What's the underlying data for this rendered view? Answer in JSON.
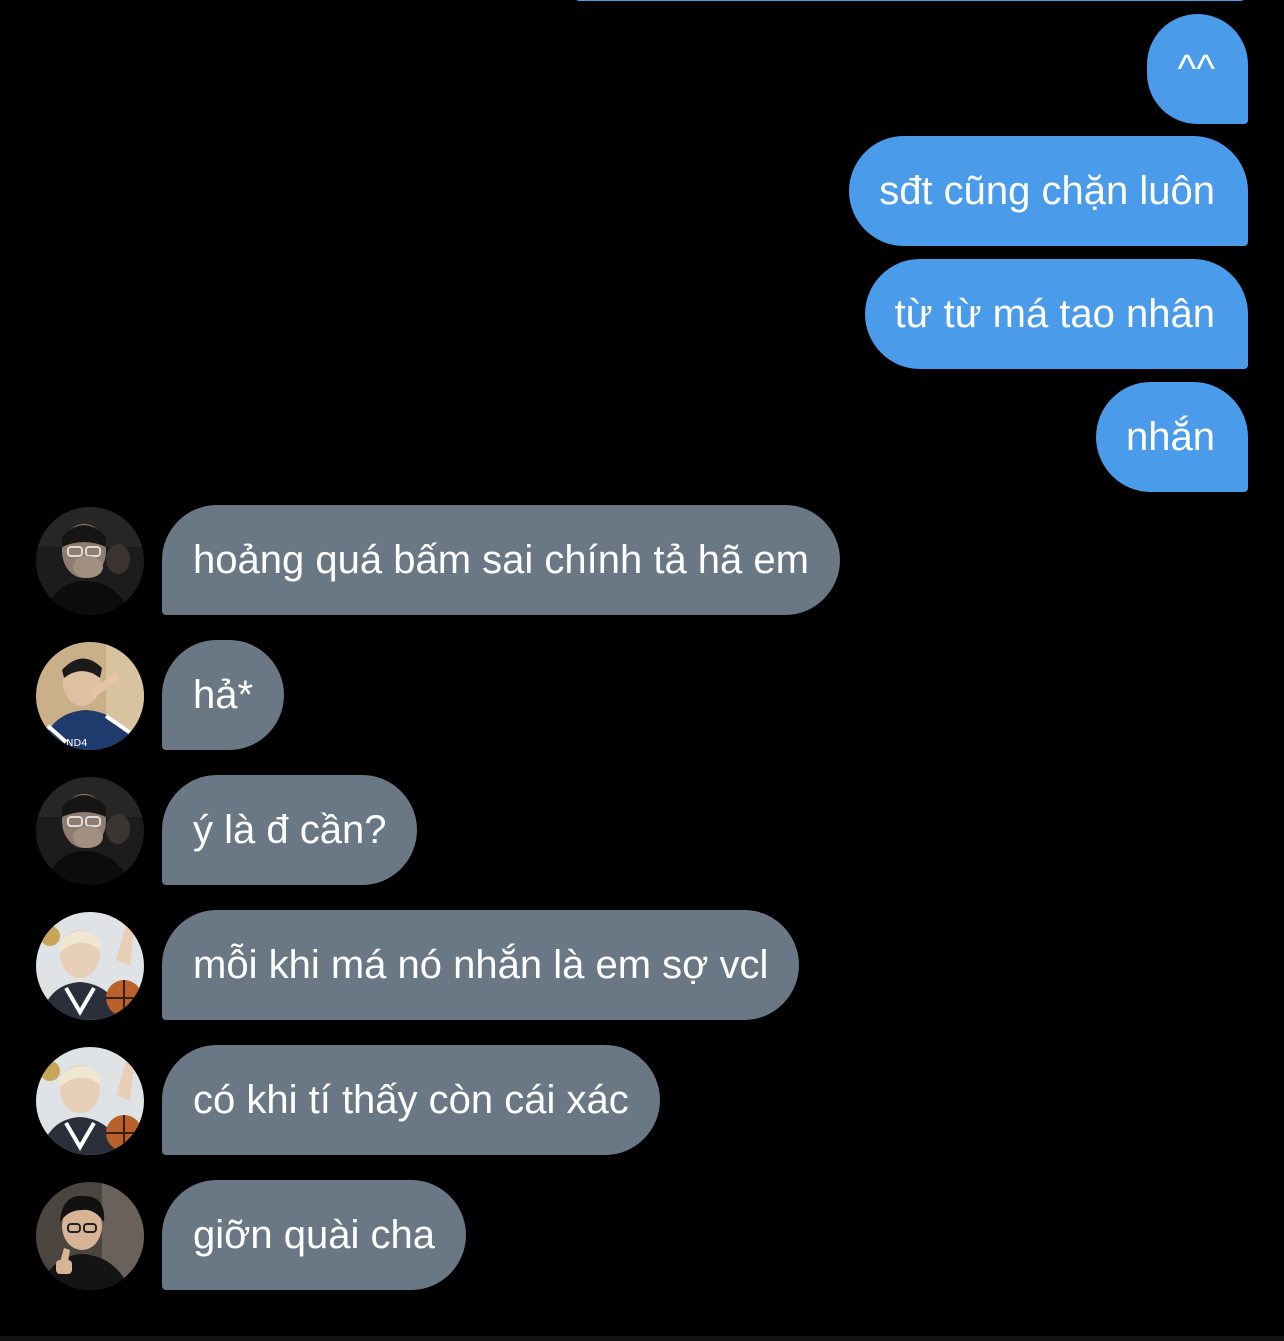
{
  "conversation": {
    "messages": [
      {
        "direction": "outgoing",
        "text": "^^"
      },
      {
        "direction": "outgoing",
        "text": "sđt cũng chặn luôn"
      },
      {
        "direction": "outgoing",
        "text": "từ từ má tao nhân"
      },
      {
        "direction": "outgoing",
        "text": "nhắn"
      },
      {
        "direction": "incoming",
        "text": "hoảng quá bấm sai chính tả hã em"
      },
      {
        "direction": "incoming",
        "text": "hả*"
      },
      {
        "direction": "incoming",
        "text": "ý là đ cần?"
      },
      {
        "direction": "incoming",
        "text": "mỗi khi má nó nhắn là em sợ vcl"
      },
      {
        "direction": "incoming",
        "text": "có khi tí thấy còn cái xác"
      },
      {
        "direction": "incoming",
        "text": "giỡn quài cha"
      }
    ]
  },
  "colors": {
    "background": "#000000",
    "outgoing_bubble": "#4a9bea",
    "incoming_bubble": "#6a7785",
    "text": "#ffffff"
  }
}
